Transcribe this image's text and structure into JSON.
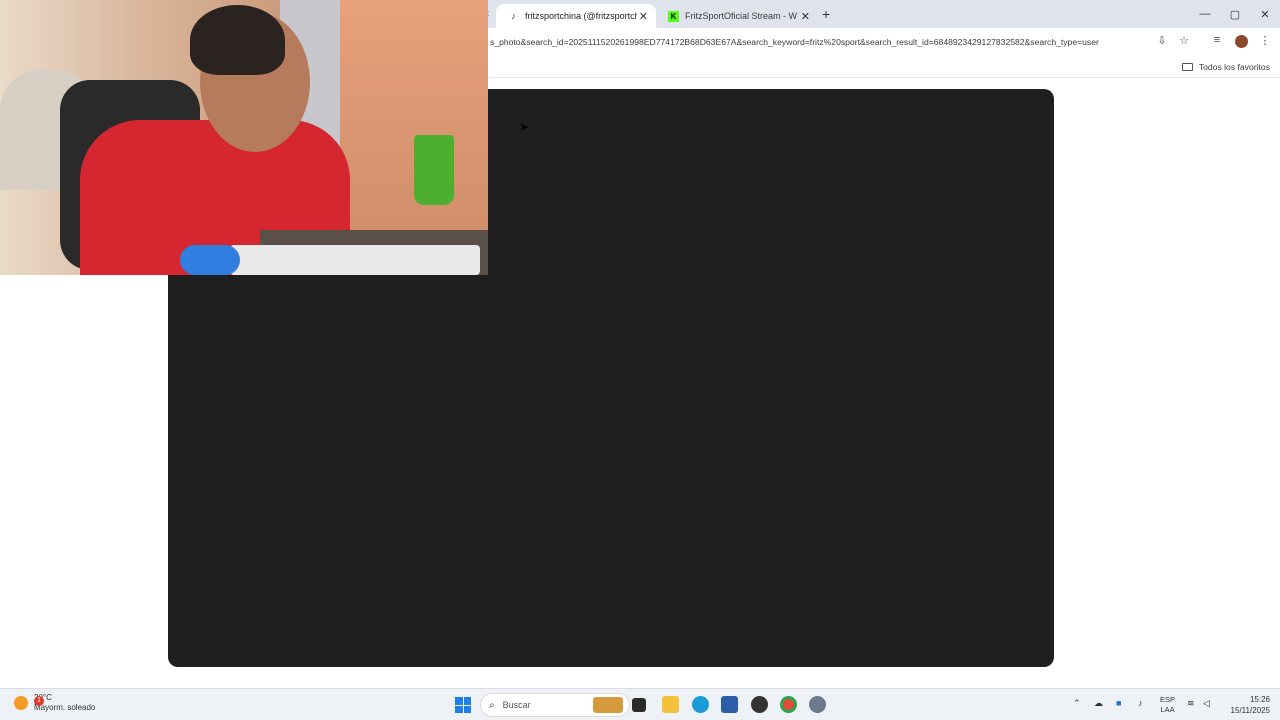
{
  "browser": {
    "tabs": [
      {
        "title": "fritzsportchina (@fritzsportchi",
        "favicon": "tiktok-icon",
        "active": true
      },
      {
        "title": "FritzSportOficial Stream - Watc",
        "favicon": "kick-icon",
        "active": false
      }
    ],
    "tab_close": "✕",
    "new_tab": "+",
    "url": "s_photo&search_id=2025111520261998ED774172B68D63E67A&search_keyword=fritz%20sport&search_result_id=6848923429127832582&search_type=user",
    "bookmarks_all": "Todos los favoritos",
    "window_controls": {
      "minimize": "—",
      "maximize": "▢",
      "close": "✕"
    }
  },
  "taskbar": {
    "weather": {
      "temp": "20°C",
      "desc": "Mayorm. soleado",
      "badge": "1"
    },
    "search_placeholder": "Buscar",
    "language": {
      "line1": "ESP",
      "line2": "LAA"
    },
    "clock": {
      "time": "15:26",
      "date": "15/11/2025"
    }
  },
  "colors": {
    "media_panel": "#1f1f1f",
    "tabstrip": "#dfe3eb",
    "taskbar": "#eef1f6"
  }
}
